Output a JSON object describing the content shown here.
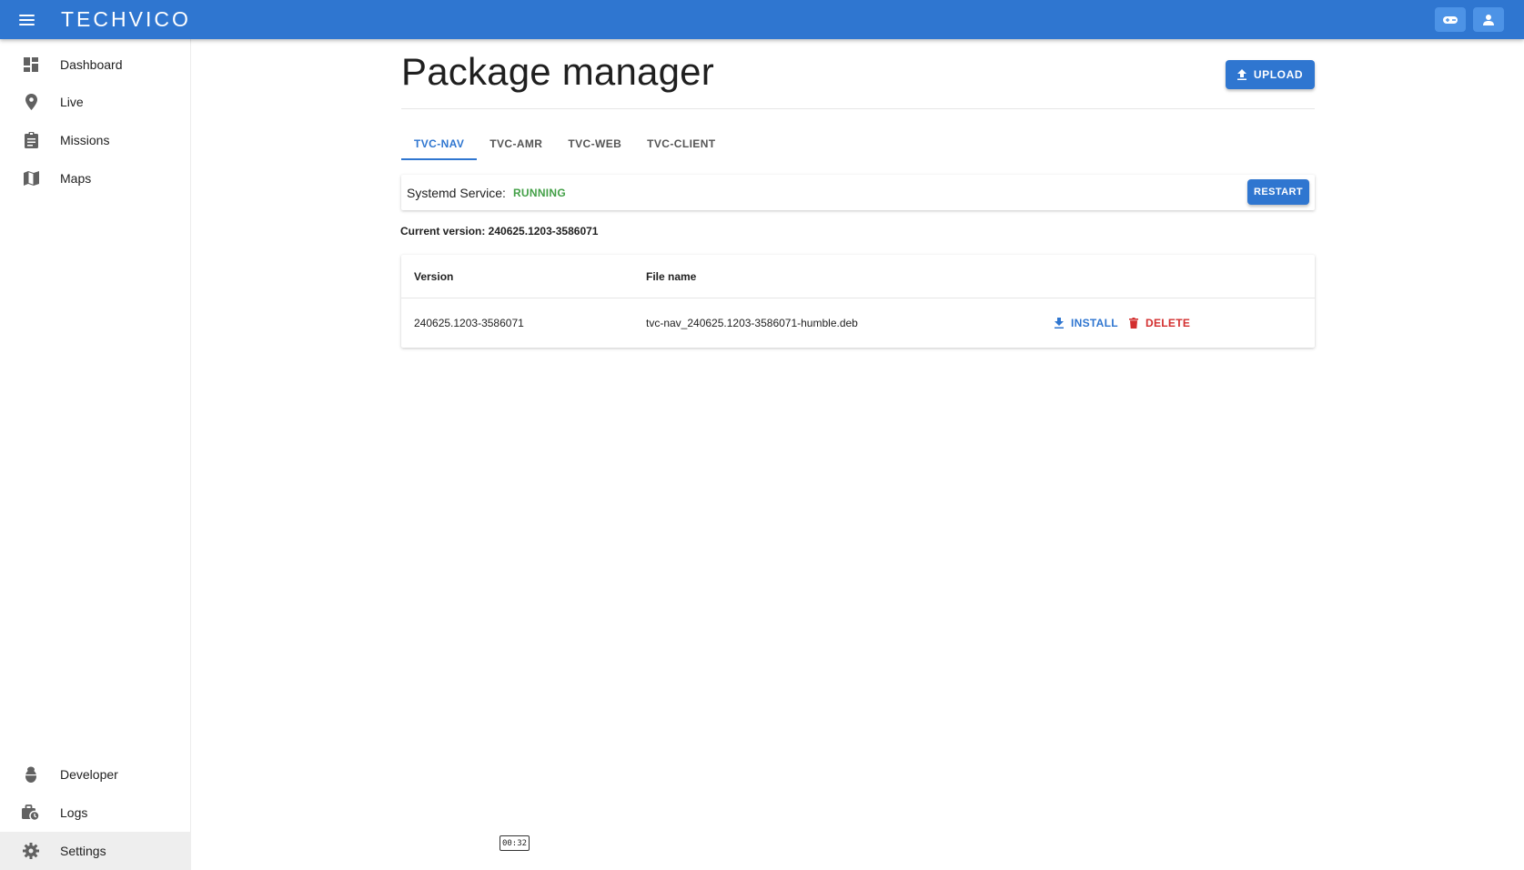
{
  "header": {
    "logo": "TECHVICO",
    "colors": {
      "bar": "#2f76d0",
      "button": "#4d93e6"
    },
    "icons": [
      "menu-icon",
      "controller-icon",
      "account-icon"
    ]
  },
  "sidebar": {
    "items": [
      {
        "label": "Dashboard",
        "icon": "dashboard-icon"
      },
      {
        "label": "Live",
        "icon": "location-pin-icon"
      },
      {
        "label": "Missions",
        "icon": "clipboard-icon"
      },
      {
        "label": "Maps",
        "icon": "map-icon"
      },
      {
        "label": "Developer",
        "icon": "bug-icon"
      },
      {
        "label": "Logs",
        "icon": "briefcase-clock-icon"
      },
      {
        "label": "Settings",
        "icon": "gear-icon",
        "active": true
      }
    ]
  },
  "main": {
    "title": "Package manager",
    "upload_label": "UPLOAD",
    "tabs": [
      {
        "label": "TVC-NAV",
        "active": true
      },
      {
        "label": "TVC-AMR"
      },
      {
        "label": "TVC-WEB"
      },
      {
        "label": "TVC-CLIENT"
      }
    ],
    "service": {
      "label": "Systemd Service:",
      "status": "RUNNING",
      "restart_label": "RESTART"
    },
    "current_version": "Current version: 240625.1203-3586071",
    "table": {
      "columns": [
        "Version",
        "File name"
      ],
      "rows": [
        {
          "version": "240625.1203-3586071",
          "file_name": "tvc-nav_240625.1203-3586071-humble.deb",
          "install_label": "INSTALL",
          "delete_label": "DELETE"
        }
      ]
    }
  },
  "overlay": {
    "timestamp": "00:32"
  }
}
